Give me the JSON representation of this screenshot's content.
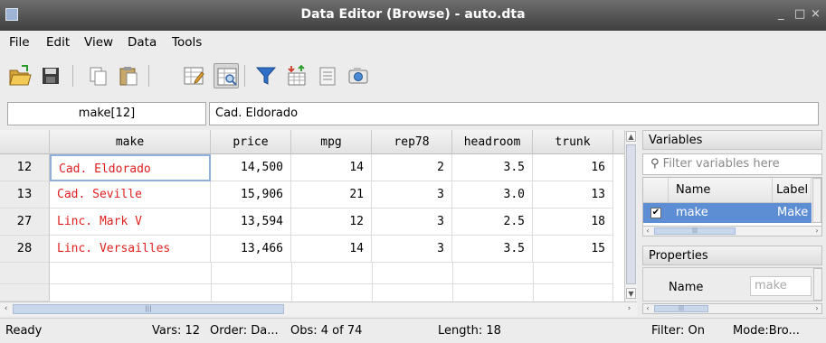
{
  "window": {
    "title": "Data Editor (Browse) - auto.dta",
    "minimize": "_",
    "maximize": "□",
    "close": "×"
  },
  "menu": [
    "File",
    "Edit",
    "View",
    "Data",
    "Tools"
  ],
  "toolbar": [
    "open-icon",
    "save-icon",
    "copy-icon",
    "paste-icon",
    "edit-mode-icon",
    "browse-mode-icon",
    "filter-icon",
    "variables-icon",
    "properties-icon",
    "snapshot-icon"
  ],
  "cellbar": {
    "name": "make[12]",
    "value": "Cad. Eldorado"
  },
  "grid": {
    "columns": [
      "make",
      "price",
      "mpg",
      "rep78",
      "headroom",
      "trunk"
    ],
    "rows": [
      {
        "num": "12",
        "cells": [
          "Cad. Eldorado",
          "14,500",
          "14",
          "2",
          "3.5",
          "16"
        ]
      },
      {
        "num": "13",
        "cells": [
          "Cad. Seville",
          "15,906",
          "21",
          "3",
          "3.0",
          "13"
        ]
      },
      {
        "num": "27",
        "cells": [
          "Linc. Mark V",
          "13,594",
          "12",
          "3",
          "2.5",
          "18"
        ]
      },
      {
        "num": "28",
        "cells": [
          "Linc. Versailles",
          "13,466",
          "14",
          "3",
          "3.5",
          "15"
        ]
      }
    ]
  },
  "variables": {
    "title": "Variables",
    "filter_placeholder": "Filter variables here",
    "col_name": "Name",
    "col_label": "Label",
    "row_name": "make",
    "row_label": "Make",
    "checkmark": "✔"
  },
  "properties": {
    "title": "Properties",
    "name_label": "Name",
    "name_value": "make"
  },
  "status": {
    "ready": "Ready",
    "vars": "Vars: 12",
    "order": "Order: Da...",
    "obs": "Obs: 4 of 74",
    "length": "Length: 18",
    "filter": "Filter: On",
    "mode": "Mode:Bro..."
  },
  "colors": {
    "string_text": "#e02020",
    "selection": "#5d8ed4",
    "titlebar": "#4a4a4a"
  }
}
